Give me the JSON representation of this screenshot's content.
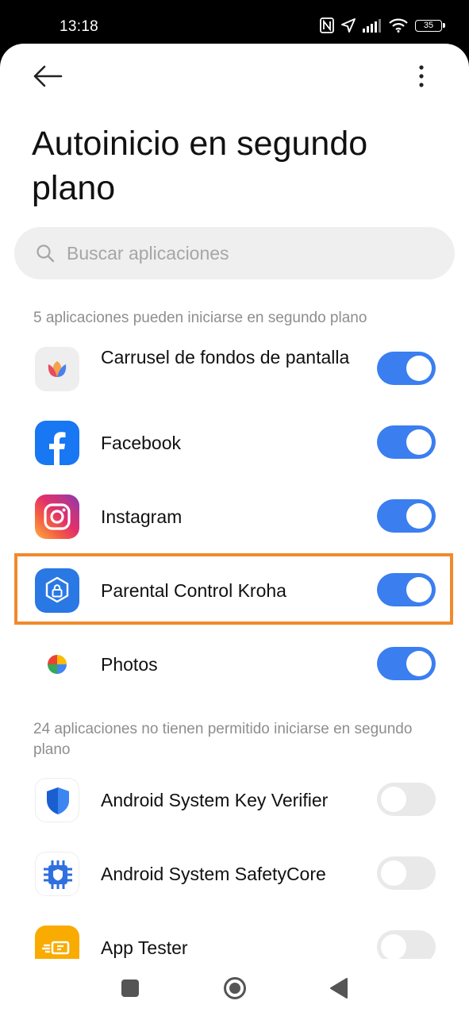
{
  "status_bar": {
    "time": "13:18",
    "battery": "35"
  },
  "header": {
    "title": "Autoinicio en segundo plano",
    "back_icon": "arrow-left-icon",
    "menu_icon": "more-vertical-icon"
  },
  "search": {
    "placeholder": "Buscar aplicaciones"
  },
  "allowed_section": {
    "header": "5 aplicaciones pueden iniciarse en segundo plano",
    "apps": [
      {
        "name": "Carrusel de fondos de pantalla",
        "enabled": true
      },
      {
        "name": "Facebook",
        "enabled": true
      },
      {
        "name": "Instagram",
        "enabled": true
      },
      {
        "name": "Parental Control Kroha",
        "enabled": true,
        "highlighted": true
      },
      {
        "name": "Photos",
        "enabled": true
      }
    ]
  },
  "blocked_section": {
    "header": "24 aplicaciones no tienen permitido iniciarse en segundo plano",
    "apps": [
      {
        "name": "Android System Key Verifier",
        "enabled": false
      },
      {
        "name": "Android System SafetyCore",
        "enabled": false
      },
      {
        "name": "App Tester",
        "enabled": false
      }
    ]
  },
  "colors": {
    "toggle_on": "#3a7ef0",
    "toggle_off": "#e9e9e9",
    "highlight": "#f08a2c"
  }
}
